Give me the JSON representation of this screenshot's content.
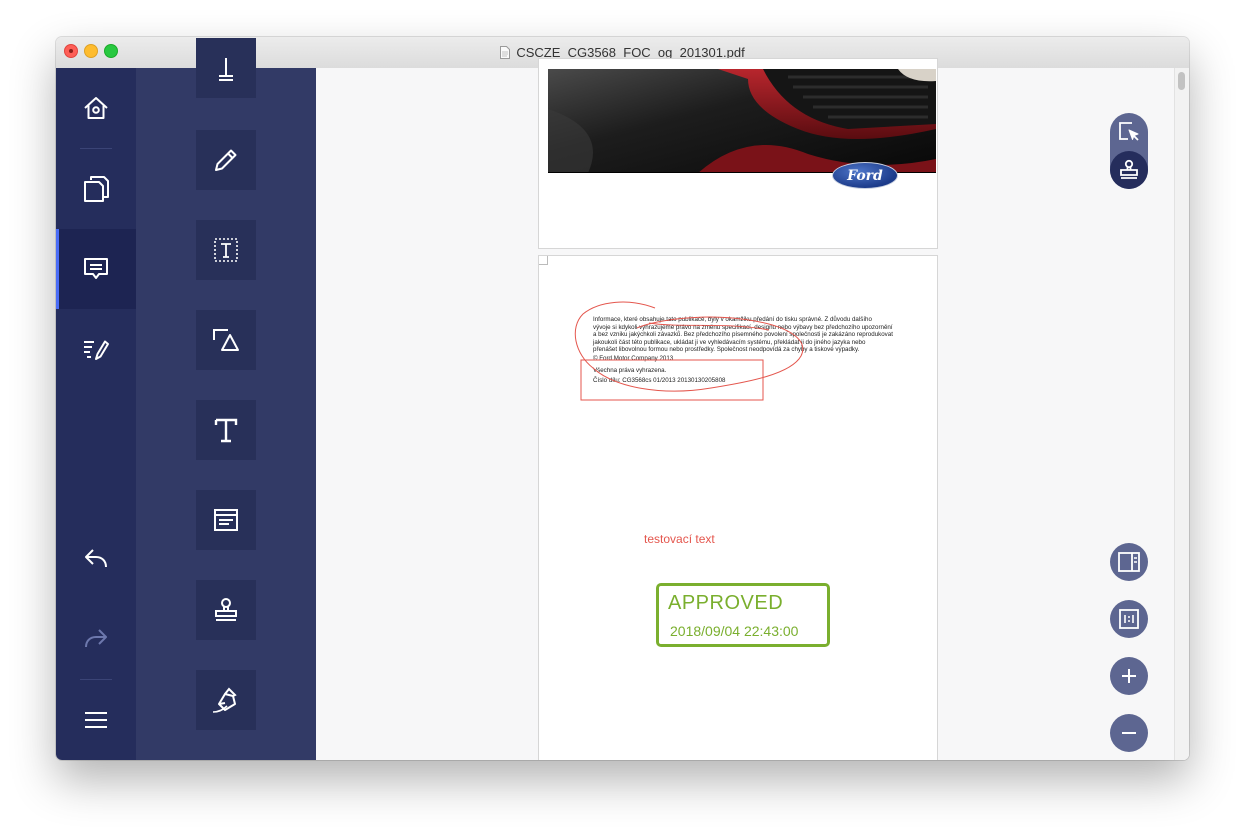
{
  "window": {
    "title": "CSCZE_CG3568_FOC_og_201301.pdf"
  },
  "nav": {
    "items": [
      {
        "icon": "home-icon",
        "active": false
      },
      {
        "icon": "pages-icon",
        "active": false
      },
      {
        "icon": "comment-icon",
        "active": true
      },
      {
        "icon": "edit-form-icon",
        "active": false
      },
      {
        "icon": "undo-icon",
        "active": false
      },
      {
        "icon": "redo-icon",
        "active": false,
        "disabled": true
      },
      {
        "icon": "menu-icon",
        "active": false
      }
    ]
  },
  "tools": [
    {
      "icon": "text-cursor-icon"
    },
    {
      "icon": "pencil-icon"
    },
    {
      "icon": "text-box-icon"
    },
    {
      "icon": "shapes-icon"
    },
    {
      "icon": "text-icon"
    },
    {
      "icon": "note-icon"
    },
    {
      "icon": "stamp-icon"
    },
    {
      "icon": "signature-pen-icon"
    }
  ],
  "page2": {
    "paragraph": [
      "Informace, které obsahuje tato publikace, byly v okamžiku předání do tisku správné. Z důvodu dalšího",
      "vývoje si kdykoli vyhrazujeme právo na změnu specifikací, designu nebo výbavy bez předchozího upozornění",
      "a bez vzniku jakýchkoli závazků. Bez předchozího písemného povolení společnosti je zakázáno reprodukovat",
      "jakoukoli část této publikace, ukládat ji ve vyhledávacím systému, překládat ji do jiného jazyka nebo",
      "přenášet libovolnou formou nebo prostředky. Společnost neodpovídá za chyby a tiskové výpadky."
    ],
    "copyright": "© Ford Motor Company 2013",
    "rights": "Všechna práva vyhrazena.",
    "part_number": "Číslo dílu: CG3568cs 01/2013 20130130205808",
    "annotation_text": "testovací text",
    "stamp": {
      "title": "APPROVED",
      "date": "2018/09/04 22:43:00",
      "color": "#7aaf2e"
    }
  },
  "page1": {
    "logo_text": "Ford"
  },
  "colors": {
    "nav_bg": "#252d5c",
    "tools_bg": "#323a66",
    "accent": "#4a6cf7",
    "annotation_red": "#e4564d"
  },
  "right_toolbar": [
    {
      "icon": "select-icon",
      "selected": false
    },
    {
      "icon": "stamp-mode-icon",
      "selected": true
    },
    {
      "icon": "single-page-icon"
    },
    {
      "icon": "actual-size-icon"
    },
    {
      "icon": "zoom-in-icon"
    },
    {
      "icon": "zoom-out-icon"
    }
  ]
}
